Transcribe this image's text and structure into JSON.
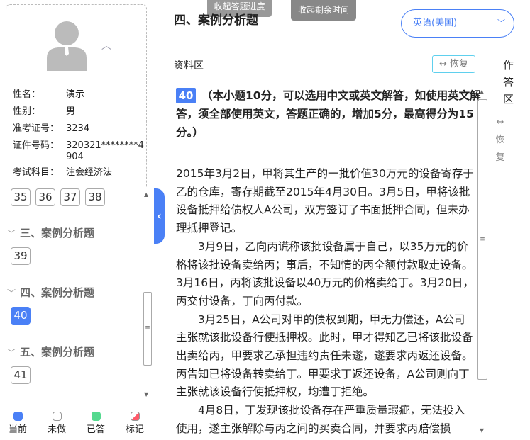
{
  "candidate": {
    "fields": [
      {
        "label": "性名：",
        "value": "演示"
      },
      {
        "label": "性别：",
        "value": "男"
      },
      {
        "label": "准考证号：",
        "value": "3234"
      },
      {
        "label": "证件号码：",
        "value": "320321********4904"
      },
      {
        "label": "考试科目：",
        "value": "注会经济法"
      }
    ]
  },
  "nav": {
    "top_numbers": [
      "35",
      "36",
      "37",
      "38"
    ],
    "sections": [
      {
        "title": "三、案例分析题",
        "questions": [
          "39"
        ]
      },
      {
        "title": "四、案例分析题",
        "questions": [
          "40"
        ]
      },
      {
        "title": "五、案例分析题",
        "questions": [
          "41"
        ]
      }
    ],
    "legend": [
      {
        "label": "当前",
        "color": "#4a80f6"
      },
      {
        "label": "未做",
        "color": "#ffffff"
      },
      {
        "label": "已答",
        "color": "#55d98f"
      },
      {
        "label": "标记",
        "color": "#ff5a6a"
      }
    ]
  },
  "header": {
    "collapse_progress": "收起答题进度",
    "collapse_time": "收起剩余时间",
    "section_title": "四、案例分析题",
    "language": "英语(美国)"
  },
  "material": {
    "label": "资料区",
    "restore": "↔ 恢复",
    "answer_area": "作答区",
    "answer_restore_icon": "↔",
    "answer_restore": "恢复"
  },
  "question": {
    "number": "40",
    "instruction": "（本小题10分，可以选用中文或英文解答，如使用英文解答，须全部使用英文，答题正确的，增加5分，最高得分为15分。）",
    "paragraphs": [
      "2015年3月2日，甲将其生产的一批价值30万元的设备寄存于乙的仓库，寄存期截至2015年4月30日。3月5日，甲将该批设备抵押给债权人A公司，双方签订了书面抵押合同，但未办理抵押登记。",
      "3月9日，乙向丙谎称该批设备属于自己，以35万元的价格将该批设备卖给丙；事后，不知情的丙全额付款取走设备。3月16日，丙将该批设备以40万元的价格卖给丁。3月20日，丙交付设备，丁向丙付款。",
      "3月25日，A公司对甲的债权到期，甲无力偿还，A公司主张就该批设备行使抵押权。此时，甲才得知乙已将该批设备出卖给丙，甲要求乙承担违约责任未遂，遂要求丙返还设备。丙告知已将设备转卖给丁。甲要求丁返还设备，A公司则向丁主张就该设备行使抵押权，均遭丁拒绝。",
      "4月8日，丁发现该批设备存在严重质量瑕疵，无法投入使用，遂主张解除与丙之间的买卖合同，并要求丙赔偿损"
    ]
  }
}
